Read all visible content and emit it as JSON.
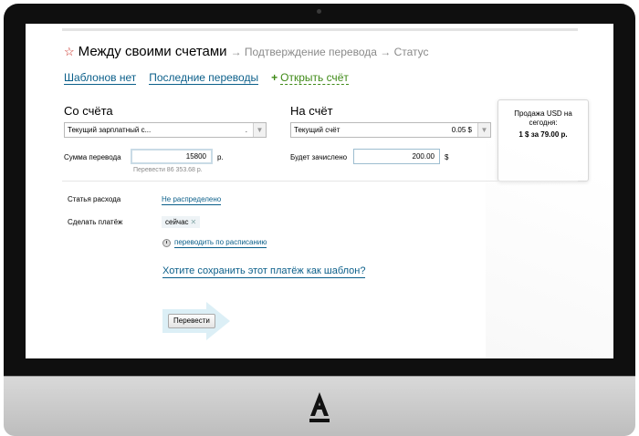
{
  "header": {
    "title": "Между своими счетами",
    "steps": "→ Подтверждение перевода → Статус"
  },
  "links": {
    "templates": "Шаблонов нет",
    "recent": "Последние переводы",
    "open_account": "Открыть счёт"
  },
  "from": {
    "heading": "Со счёта",
    "account": "Текущий зарплатный с...",
    "dot": ".",
    "amount_label": "Сумма перевода",
    "amount": "15800",
    "currency": "р.",
    "hint": "Перевести 86 353.68 р."
  },
  "to": {
    "heading": "На счёт",
    "account": "Текущий счёт",
    "balance": "0.05 $",
    "credited_label": "Будет зачислено",
    "credited": "200.00",
    "currency": "$"
  },
  "rate": {
    "title": "Продажа USD на сегодня:",
    "value": "1 $ за 79.00 р."
  },
  "expense": {
    "label": "Статья расхода",
    "value": "Не распределено"
  },
  "payment": {
    "label": "Сделать платёж",
    "chip": "сейчас",
    "schedule": "переводить по расписанию"
  },
  "save_template": "Хотите сохранить этот платёж как шаблон?",
  "submit": "Перевести",
  "colors": {
    "link": "#0b5f8a",
    "green": "#3f8a17",
    "star": "#c8261c",
    "bezel": "#0f0f0f"
  },
  "icons": {
    "star": "star-outline-icon",
    "clock": "clock-icon",
    "remove": "close-icon",
    "dropdown": "chevron-down-icon",
    "brand": "alfa-logo-icon"
  }
}
